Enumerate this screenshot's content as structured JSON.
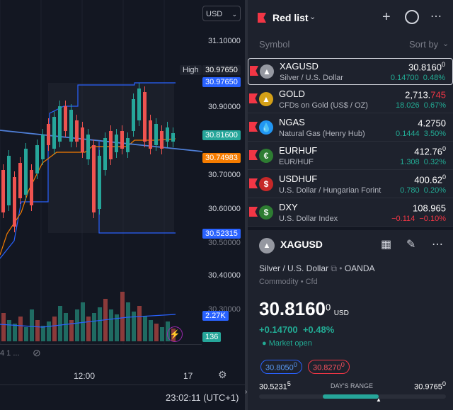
{
  "chart": {
    "currency": "USD",
    "price_labels": [
      "31.10000",
      "30.90000",
      "30.70000",
      "30.60000",
      "30.50000",
      "30.40000",
      "30.30000"
    ],
    "high_label": "High",
    "high_value": "30.97650",
    "high_value2": "30.97650",
    "last_price": "30.81600",
    "orange_value": "30.74983",
    "low_value": "30.52315",
    "volume_value": "2.27K",
    "green_value": "136",
    "x_labels": [
      "12:00",
      "17"
    ],
    "left_partial": "4 1 ...",
    "clock": "23:02:11 (UTC+1)",
    "colors": {
      "up": "#26a69a",
      "down": "#ef5350",
      "blue": "#2962ff",
      "orange": "#f57c00"
    }
  },
  "watchlist": {
    "title": "Red list",
    "col_symbol": "Symbol",
    "col_sort": "Sort by",
    "rows": [
      {
        "sym": "XAGUSD",
        "desc": "Silver / U.S. Dollar",
        "price_main": "30.81",
        "price_hl": "60",
        "price_sup": "0",
        "chg": "0.14700",
        "pct": "0.48%",
        "dir": "up",
        "logo": "silver"
      },
      {
        "sym": "GOLD",
        "desc": "CFDs on Gold (US$ / OZ)",
        "price_main": "2,713.",
        "price_hl": "745",
        "price_sup": "",
        "chg": "18.026",
        "pct": "0.67%",
        "dir": "up",
        "logo": "gold"
      },
      {
        "sym": "NGAS",
        "desc": "Natural Gas (Henry Hub)",
        "price_main": "4.27",
        "price_hl": "50",
        "price_sup": "",
        "chg": "0.1444",
        "pct": "3.50%",
        "dir": "up",
        "logo": "gas"
      },
      {
        "sym": "EURHUF",
        "desc": "EUR/HUF",
        "price_main": "412.76",
        "price_hl": "",
        "price_sup": "0",
        "chg": "1.308",
        "pct": "0.32%",
        "dir": "up",
        "logo": "eurhuf"
      },
      {
        "sym": "USDHUF",
        "desc": "U.S. Dollar / Hungarian Forint",
        "price_main": "400.6",
        "price_hl": "2",
        "price_sup": "0",
        "chg": "0.780",
        "pct": "0.20%",
        "dir": "up",
        "logo": "usdhuf"
      },
      {
        "sym": "DXY",
        "desc": "U.S. Dollar Index",
        "price_main": "108.96",
        "price_hl": "5",
        "price_sup": "",
        "chg": "−0.114",
        "pct": "−0.10%",
        "dir": "down",
        "logo": "dxy"
      }
    ]
  },
  "detail": {
    "symbol": "XAGUSD",
    "desc": "Silver / U.S. Dollar",
    "exchange": "OANDA",
    "type1": "Commodity",
    "type2": "Cfd",
    "price_main": "30.81",
    "price_hl": "60",
    "price_sup": "0",
    "currency": "USD",
    "chg": "+0.14700",
    "pct": "+0.48%",
    "status": "Market open",
    "bid": "30.8050",
    "bid_sup": "0",
    "ask": "30.8270",
    "ask_sup": "0",
    "range_low": "30.5231",
    "range_low_sup": "5",
    "range_title": "DAY'S RANGE",
    "range_high": "30.9765",
    "range_high_sup": "0",
    "range_fraction": 0.64
  }
}
